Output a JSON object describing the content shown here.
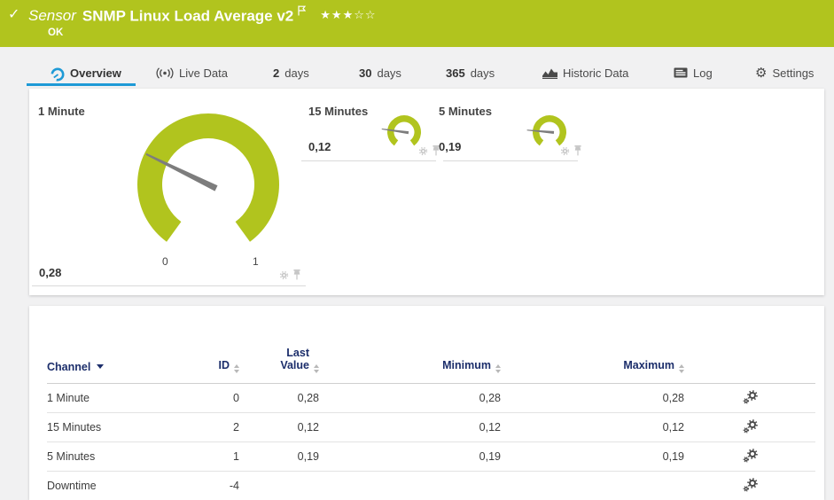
{
  "sensor": {
    "kind": "Sensor",
    "name": "SNMP Linux Load Average v2",
    "status": "OK",
    "stars_filled": "★★★",
    "stars_empty": "☆☆"
  },
  "tabs": {
    "overview": "Overview",
    "live_data": "Live Data",
    "d2_num": "2",
    "d2_label": "days",
    "d30_num": "30",
    "d30_label": "days",
    "d365_num": "365",
    "d365_label": "days",
    "historic": "Historic Data",
    "log": "Log",
    "settings": "Settings"
  },
  "gauges": {
    "minute1": {
      "label": "1 Minute",
      "value": "0,28",
      "scale_min": "0",
      "scale_max": "1"
    },
    "minutes15": {
      "label": "15 Minutes",
      "value": "0,12"
    },
    "minutes5": {
      "label": "5 Minutes",
      "value": "0,19"
    }
  },
  "table": {
    "headers": {
      "channel": "Channel",
      "id": "ID",
      "last_value": "Last Value",
      "minimum": "Minimum",
      "maximum": "Maximum"
    },
    "rows": [
      {
        "channel": "1 Minute",
        "id": "0",
        "last": "0,28",
        "min": "0,28",
        "max": "0,28"
      },
      {
        "channel": "15 Minutes",
        "id": "2",
        "last": "0,12",
        "min": "0,12",
        "max": "0,12"
      },
      {
        "channel": "5 Minutes",
        "id": "1",
        "last": "0,19",
        "min": "0,19",
        "max": "0,19"
      },
      {
        "channel": "Downtime",
        "id": "-4",
        "last": "",
        "min": "",
        "max": ""
      }
    ]
  },
  "colors": {
    "brand_green": "#b1c41e",
    "accent_blue": "#1e9ad6",
    "header_navy": "#1c2e6b"
  }
}
